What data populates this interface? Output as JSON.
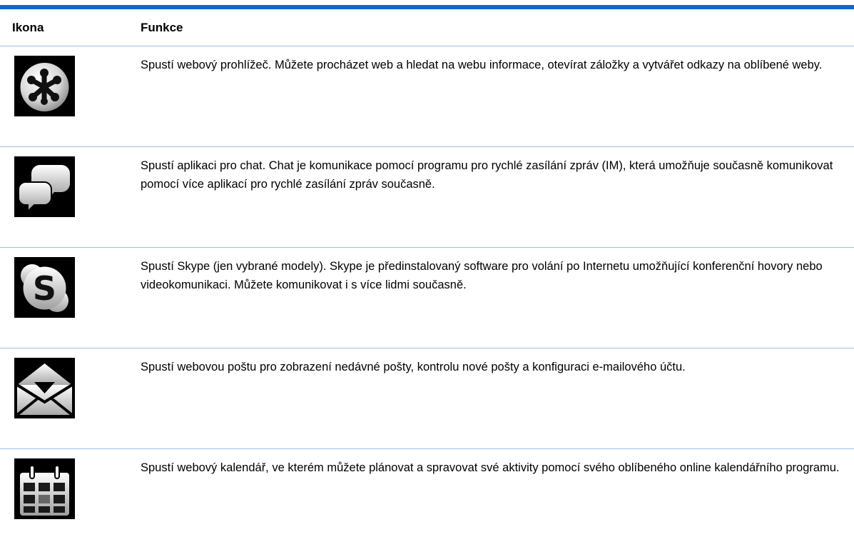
{
  "table": {
    "headers": {
      "icon": "Ikona",
      "function": "Funkce"
    },
    "rows": [
      {
        "icon": "web-browser-icon",
        "text": "Spustí webový prohlížeč. Můžete procházet web a hledat na webu informace, otevírat záložky a vytvářet odkazy na oblíbené weby."
      },
      {
        "icon": "chat-bubbles-icon",
        "text": "Spustí aplikaci pro chat. Chat je komunikace pomocí programu pro rychlé zasílání zpráv (IM), která umožňuje současně komunikovat pomocí více aplikací pro rychlé zasílání zpráv současně."
      },
      {
        "icon": "skype-icon",
        "text": "Spustí Skype (jen vybrané modely). Skype je předinstalovaný software pro volání po Internetu umožňující konferenční hovory nebo videokomunikaci. Můžete komunikovat i s více lidmi současně."
      },
      {
        "icon": "webmail-envelope-icon",
        "text": "Spustí webovou poštu pro zobrazení nedávné pošty, kontrolu nové pošty a konfiguraci e-mailového účtu."
      },
      {
        "icon": "calendar-icon",
        "text": "Spustí webový kalendář, ve kterém můžete plánovat a spravovat své aktivity pomocí svého oblíbeného online kalendářního programu."
      }
    ]
  },
  "colors": {
    "accent_rule": "#0a68d4",
    "row_divider": "#9cbde4"
  }
}
